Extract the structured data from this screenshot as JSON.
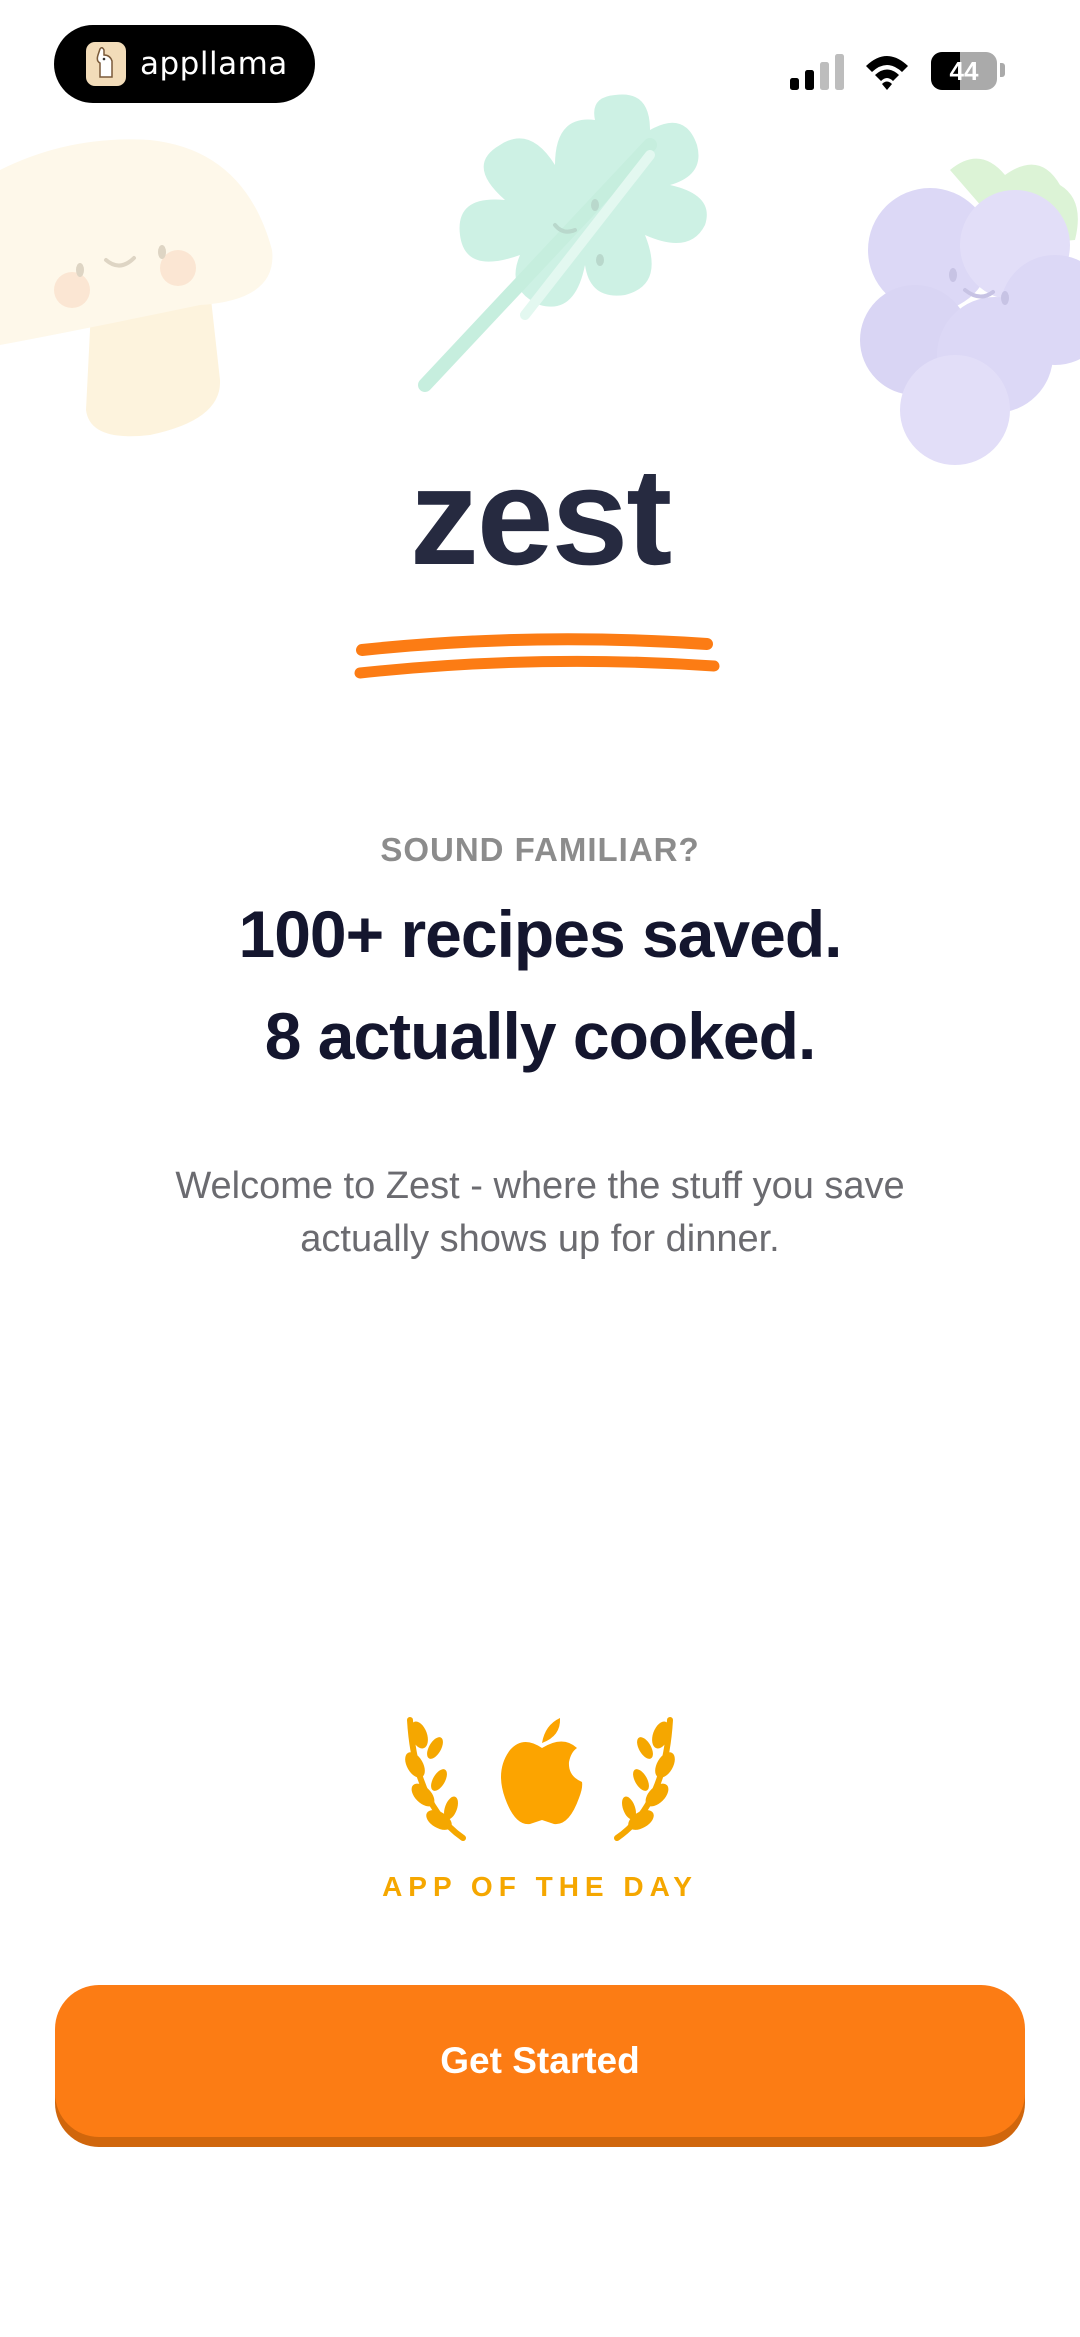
{
  "status_bar": {
    "brand_text": "appllama",
    "battery_level": "44",
    "battery_fraction": 0.44,
    "signal_bars_active": 2,
    "signal_bars_total": 4
  },
  "logo": {
    "text": "zest",
    "underline_color": "#FC7C14"
  },
  "intro": {
    "eyebrow": "SOUND FAMILIAR?",
    "headline_line1": "100+ recipes saved.",
    "headline_line2": "8 actually cooked.",
    "subtitle": "Welcome to Zest - where the stuff you save actually shows up for dinner."
  },
  "award": {
    "label": "APP OF THE DAY",
    "icon": "apple-icon",
    "color": "#F5A700"
  },
  "cta": {
    "label": "Get Started",
    "color": "#FC7C14"
  },
  "decorations": [
    "mushroom-illustration",
    "leaf-illustration",
    "grapes-illustration"
  ]
}
